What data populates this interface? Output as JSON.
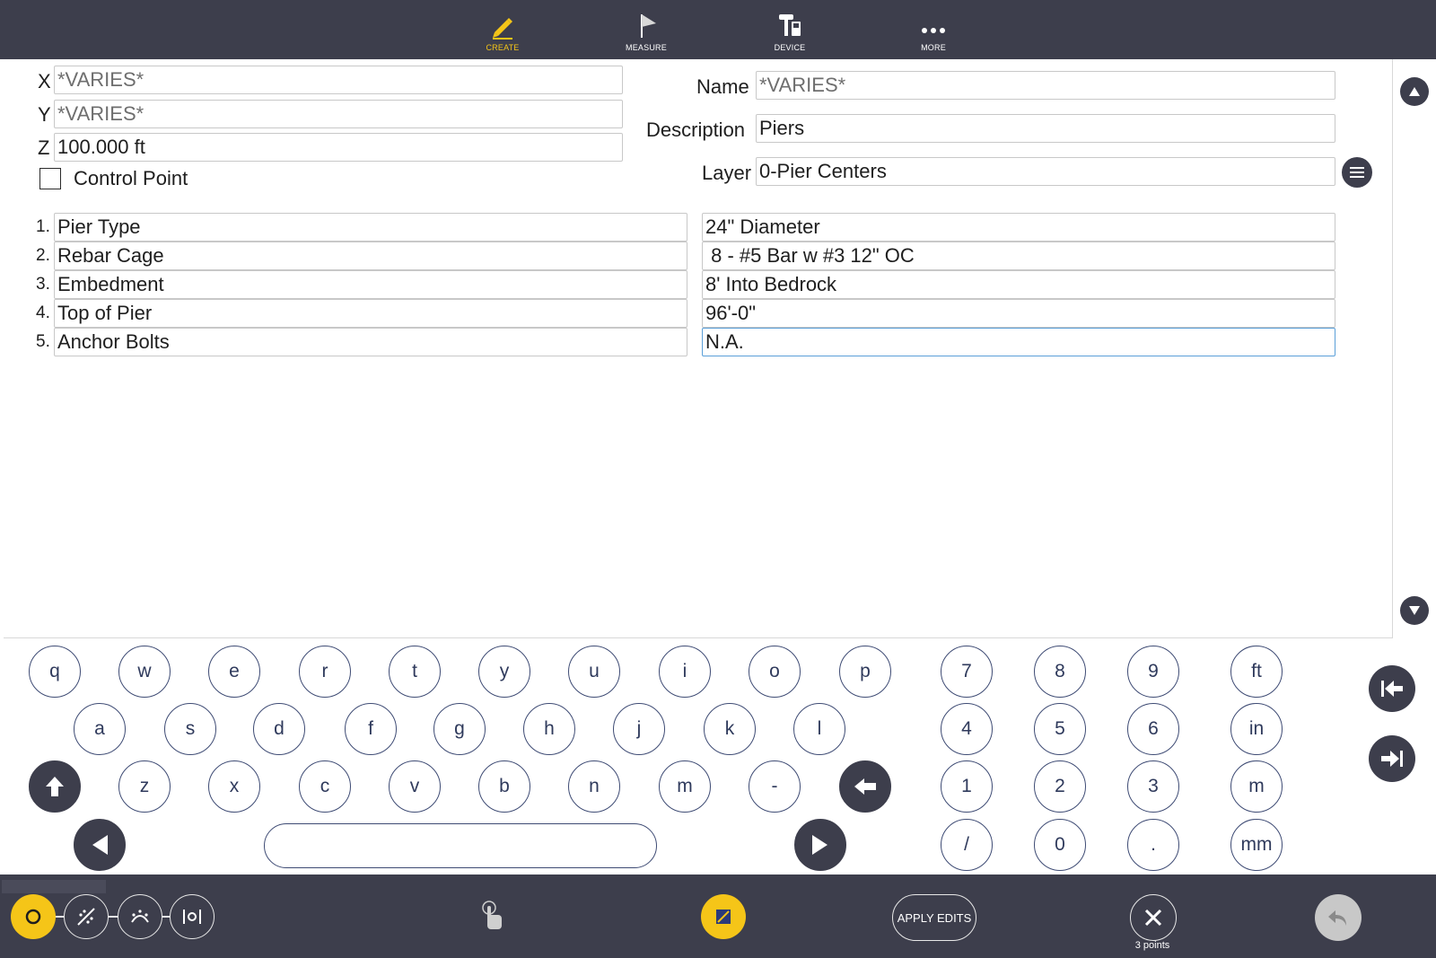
{
  "topnav": [
    {
      "label": "CREATE",
      "icon": "pencil-icon"
    },
    {
      "label": "MEASURE",
      "icon": "flag-icon"
    },
    {
      "label": "DEVICE",
      "icon": "device-icon"
    },
    {
      "label": "MORE",
      "icon": "more-icon"
    }
  ],
  "point": {
    "x_label": "X",
    "x_value": "*VARIES*",
    "y_label": "Y",
    "y_value": "*VARIES*",
    "z_label": "Z",
    "z_value": "100.000 ft",
    "control_point_label": "Control Point",
    "control_point_checked": false
  },
  "meta": {
    "name_label": "Name",
    "name_value": "*VARIES*",
    "description_label": "Description",
    "description_value": "Piers",
    "layer_label": "Layer",
    "layer_value": "0-Pier Centers"
  },
  "attributes": [
    {
      "num": "1.",
      "key": "Pier Type",
      "value": "24\" Diameter"
    },
    {
      "num": "2.",
      "key": "Rebar Cage",
      "value": " 8 - #5 Bar w #3 12\" OC"
    },
    {
      "num": "3.",
      "key": "Embedment",
      "value": "8' Into Bedrock"
    },
    {
      "num": "4.",
      "key": "Top of Pier",
      "value": "96'-0\""
    },
    {
      "num": "5.",
      "key": "Anchor Bolts",
      "value": "N.A."
    }
  ],
  "keyboard": {
    "row1": [
      "q",
      "w",
      "e",
      "r",
      "t",
      "y",
      "u",
      "i",
      "o",
      "p"
    ],
    "row2": [
      "a",
      "s",
      "d",
      "f",
      "g",
      "h",
      "j",
      "k",
      "l"
    ],
    "row3": [
      "z",
      "x",
      "c",
      "v",
      "b",
      "n",
      "m",
      "-"
    ],
    "numpad": [
      [
        "7",
        "8",
        "9",
        "ft"
      ],
      [
        "4",
        "5",
        "6",
        "in"
      ],
      [
        "1",
        "2",
        "3",
        "m"
      ],
      [
        "/",
        "0",
        ".",
        "mm"
      ]
    ]
  },
  "bottombar": {
    "apply_label": "APPLY EDITS",
    "points_count": "3 points",
    "accent_color": "#f5c518"
  }
}
